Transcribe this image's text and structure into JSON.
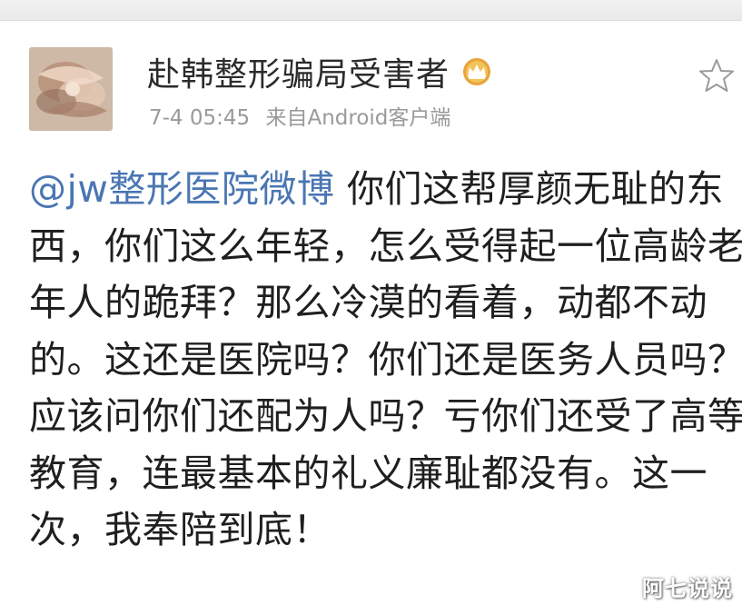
{
  "post": {
    "user_name": "赴韩整形骗局受害者",
    "timestamp": "7-4 05:45",
    "source": "来自Android客户端",
    "mention": "@jw整形医院微博",
    "text": " 你们这帮厚颜无耻的东西，你们这么年轻，怎么受得起一位高龄老年人的跪拜？那么冷漠的看着，动都不动的。这还是医院吗？你们还是医务人员吗？应该问你们还配为人吗？亏你们还受了高等教育，连最基本的礼义廉耻都没有。这一次，我奉陪到底！"
  },
  "icons": {
    "badge": "crown-badge-icon",
    "favorite": "star-icon"
  },
  "watermark": "阿七说说",
  "colors": {
    "mention": "#4a76b3",
    "meta": "#9a9a9a",
    "text": "#1f1f1f",
    "badge": "#e8a33a"
  }
}
